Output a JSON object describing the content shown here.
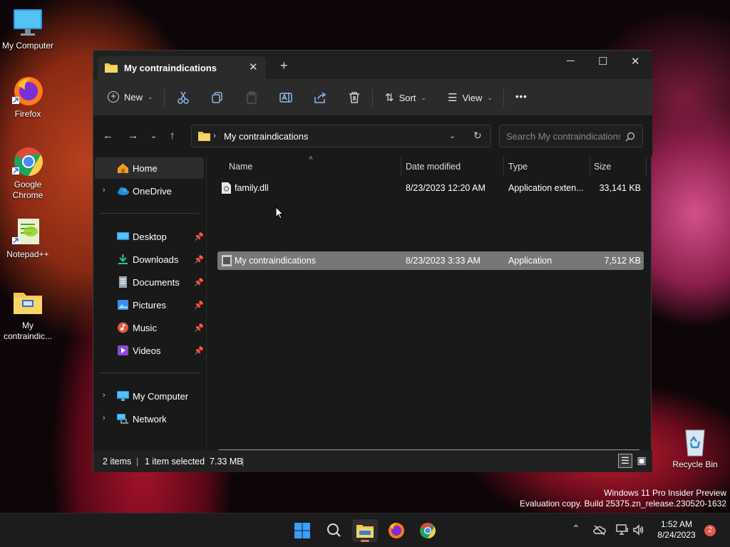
{
  "desktop": {
    "icons": [
      {
        "label": "My Computer"
      },
      {
        "label": "Firefox"
      },
      {
        "label": "Google Chrome"
      },
      {
        "label": "Notepad++"
      },
      {
        "label": "My contraindic..."
      },
      {
        "label": "Recycle Bin"
      }
    ]
  },
  "window": {
    "tab_title": "My contraindications",
    "toolbar": {
      "new_label": "New",
      "sort_label": "Sort",
      "view_label": "View",
      "more_label": "•••"
    },
    "address": {
      "path": "My contraindications",
      "search_placeholder": "Search My contraindications"
    },
    "sidebar": {
      "items": [
        {
          "label": "Home",
          "icon": "home-icon",
          "selected": true
        },
        {
          "label": "OneDrive",
          "icon": "cloud-icon"
        },
        {
          "label": "Desktop",
          "icon": "desktop-icon",
          "pinned": true
        },
        {
          "label": "Downloads",
          "icon": "download-icon",
          "pinned": true
        },
        {
          "label": "Documents",
          "icon": "document-icon",
          "pinned": true
        },
        {
          "label": "Pictures",
          "icon": "picture-icon",
          "pinned": true
        },
        {
          "label": "Music",
          "icon": "music-icon",
          "pinned": true
        },
        {
          "label": "Videos",
          "icon": "video-icon",
          "pinned": true
        },
        {
          "label": "My Computer",
          "icon": "computer-icon"
        },
        {
          "label": "Network",
          "icon": "network-icon"
        }
      ]
    },
    "columns": [
      "Name",
      "Date modified",
      "Type",
      "Size"
    ],
    "files": [
      {
        "name": "family.dll",
        "date": "8/23/2023 12:20 AM",
        "type": "Application exten...",
        "size": "33,141 KB",
        "selected": false
      },
      {
        "name": "My contraindications",
        "date": "8/23/2023 3:33 AM",
        "type": "Application",
        "size": "7,512 KB",
        "selected": true
      }
    ],
    "status": {
      "count": "2 items",
      "selected": "1 item selected  7.33 MB"
    }
  },
  "watermark": {
    "line1": "Windows 11 Pro Insider Preview",
    "line2": "Evaluation copy. Build 25375.zn_release.230520-1632"
  },
  "taskbar": {
    "time": "1:52 AM",
    "date": "8/24/2023",
    "notification_count": "2"
  }
}
